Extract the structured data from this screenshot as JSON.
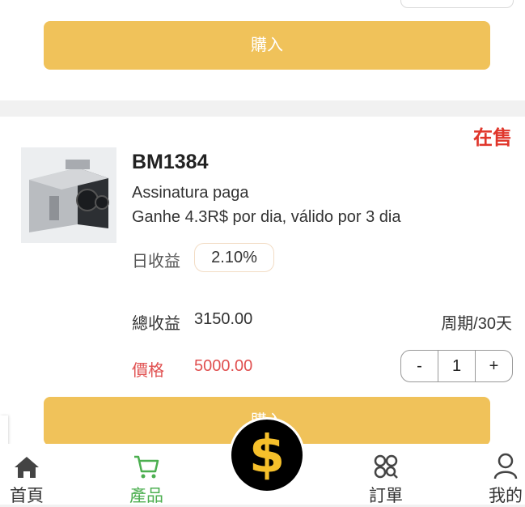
{
  "top_card": {
    "buy_label": "購入"
  },
  "product": {
    "status": "在售",
    "name": "BM1384",
    "line1": "Assinatura paga",
    "line2": "Ganhe 4.3R$ por dia, válido por 3 dia",
    "daily_label": "日收益",
    "daily_value": "2.10%",
    "total_label": "總收益",
    "total_value": "3150.00",
    "period": "周期/30天",
    "price_label": "價格",
    "price_value": "5000.00",
    "quantity": "1",
    "minus": "-",
    "plus": "+",
    "buy_label": "購入"
  },
  "nav": {
    "items": [
      {
        "label": "首頁",
        "icon": "home-icon"
      },
      {
        "label": "產品",
        "icon": "cart-icon",
        "active": true
      },
      {
        "label": "訂單",
        "icon": "orders-icon"
      },
      {
        "label": "我的",
        "icon": "user-icon"
      }
    ],
    "center_symbol": "$"
  },
  "colors": {
    "accent": "#f0c25a",
    "status": "#e0362b",
    "active_nav": "#4caf50",
    "center_symbol": "#f6c02b"
  }
}
